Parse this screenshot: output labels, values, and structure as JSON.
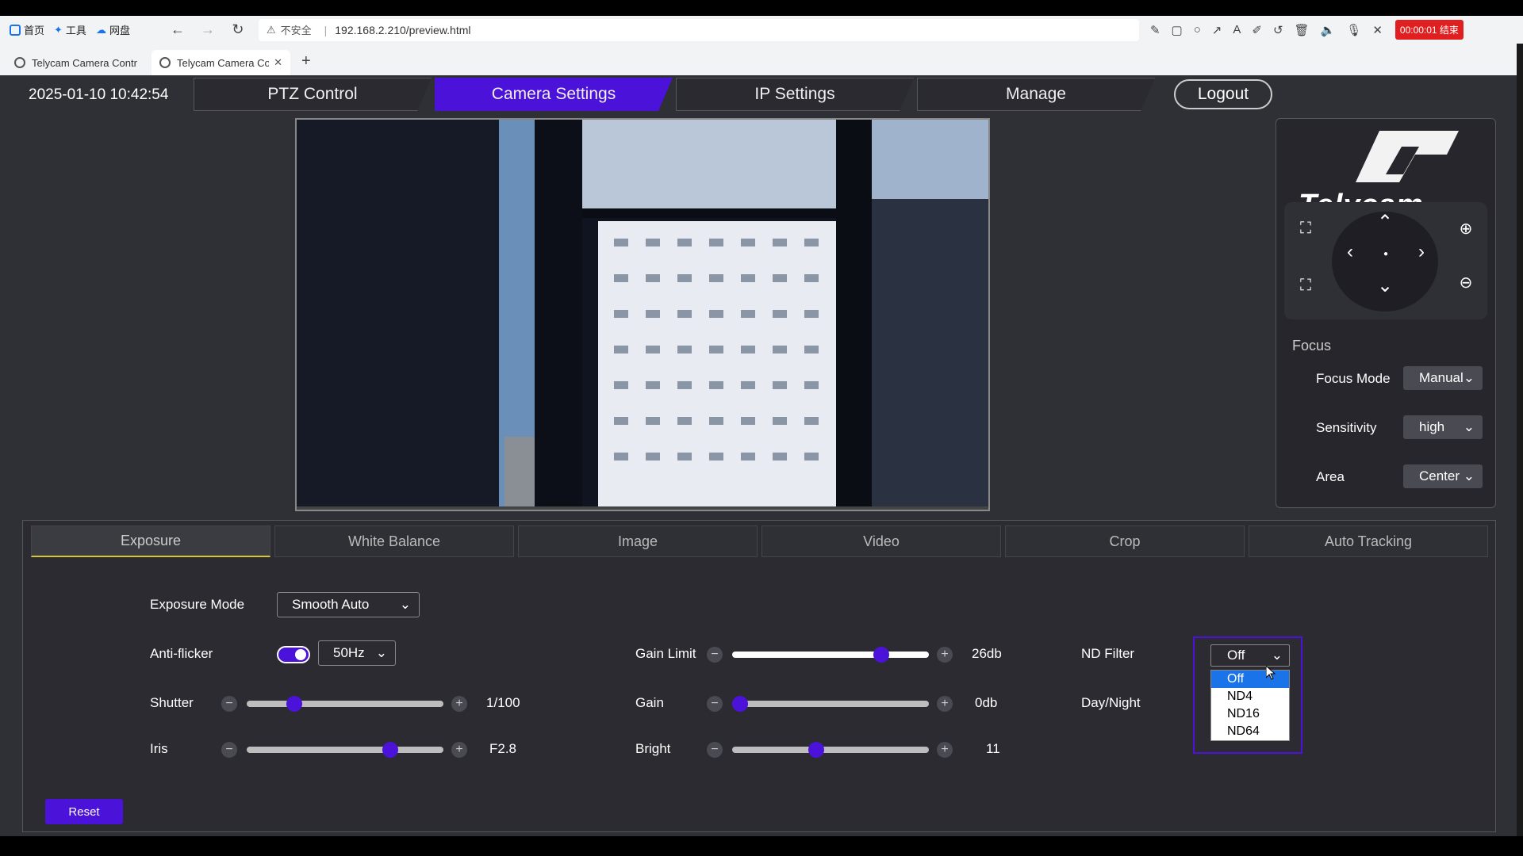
{
  "browser": {
    "bookmarks": [
      "首页",
      "工具",
      "网盘"
    ],
    "security_label": "不安全",
    "url": "192.168.2.210/preview.html",
    "rec_badge": "00:00:01 结束",
    "tabs": [
      {
        "title": "Telycam Camera Contr"
      },
      {
        "title": "Telycam Camera Co"
      }
    ]
  },
  "header": {
    "datetime": "2025-01-10 10:42:54",
    "nav": [
      "PTZ Control",
      "Camera Settings",
      "IP Settings",
      "Manage"
    ],
    "active_nav": "Camera Settings",
    "logout": "Logout"
  },
  "brand": {
    "logo_text": "Telycam"
  },
  "focus": {
    "title": "Focus",
    "rows": [
      {
        "label": "Focus Mode",
        "value": "Manual"
      },
      {
        "label": "Sensitivity",
        "value": "high"
      },
      {
        "label": "Area",
        "value": "Center"
      }
    ]
  },
  "settings": {
    "tabs": [
      "Exposure",
      "White Balance",
      "Image",
      "Video",
      "Crop",
      "Auto Tracking"
    ],
    "active_tab": "Exposure",
    "exposure_mode": {
      "label": "Exposure Mode",
      "value": "Smooth Auto"
    },
    "anti_flicker": {
      "label": "Anti-flicker",
      "enabled": true,
      "value": "50Hz"
    },
    "shutter": {
      "label": "Shutter",
      "value": "1/100",
      "level": 0.22
    },
    "iris": {
      "label": "Iris",
      "value": "F2.8",
      "level": 0.75
    },
    "gain_limit": {
      "label": "Gain Limit",
      "value": "26db",
      "level": 0.78
    },
    "gain": {
      "label": "Gain",
      "value": "0db",
      "level": 0.0
    },
    "bright": {
      "label": "Bright",
      "value": "11",
      "level": 0.42
    },
    "nd_filter": {
      "label": "ND Filter",
      "value": "Off",
      "options": [
        "Off",
        "ND4",
        "ND16",
        "ND64"
      ],
      "highlighted": "Off"
    },
    "day_night": {
      "label": "Day/Night"
    },
    "reset": "Reset"
  },
  "colors": {
    "accent": "#4b12d9",
    "panel_bg": "#2f2f36",
    "tab_underline": "#d6c73a"
  }
}
